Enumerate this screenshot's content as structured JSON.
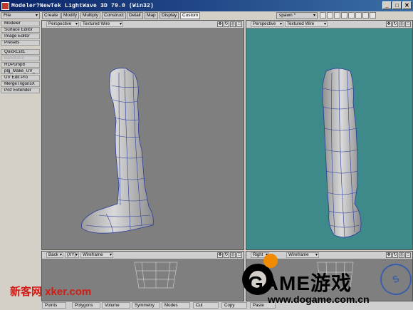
{
  "window": {
    "title": "Modeler?NewTek LightWave 3D 79.0 (Win32)",
    "buttons": [
      "_",
      "□",
      "✕"
    ]
  },
  "menu": {
    "file": "File",
    "modeler": "Modeler"
  },
  "tabs": [
    "Create",
    "Modify",
    "Multiply",
    "Construct",
    "Detail",
    "Map",
    "Display",
    "Custom"
  ],
  "active_tab": "Custom",
  "layer": {
    "name": "spawn *"
  },
  "sidebar": {
    "items": [
      "Surface Editor",
      "Image Editor",
      "Presets",
      "QuickCut1",
      "BandGlue",
      "HDPump8",
      "plg_Make_UV_",
      "UV Edit Pro",
      "MergeTrigonsX",
      "Poz Extender"
    ],
    "disabled_item": "BandGlue"
  },
  "viewports": {
    "top_left": {
      "view": "Perspective",
      "mode": "Textured Wire"
    },
    "top_right": {
      "view": "Perspective",
      "mode": "Textured Wire"
    },
    "bottom_left": {
      "view": "Back",
      "axis": "(XY)",
      "mode": "Wireframe"
    },
    "bottom_right": {
      "view": "Right",
      "mode": "Wireframe"
    }
  },
  "bottom_toolbar": [
    "Points",
    "Polygons",
    "Volume",
    "Symmetry",
    "Modes",
    "Cut",
    "Copy",
    "Paste"
  ],
  "watermarks": {
    "left": "新客网 xker.com",
    "game_logo": "GAME游戏",
    "url": "www.dogame.com.cn",
    "seal": "S"
  },
  "colors": {
    "viewport_grey": "#7f7f7f",
    "viewport_teal": "#3e8a8a",
    "wire": "#2b3c9c",
    "model_light": "#d8d8d8",
    "model_dark": "#8a8a8a"
  }
}
